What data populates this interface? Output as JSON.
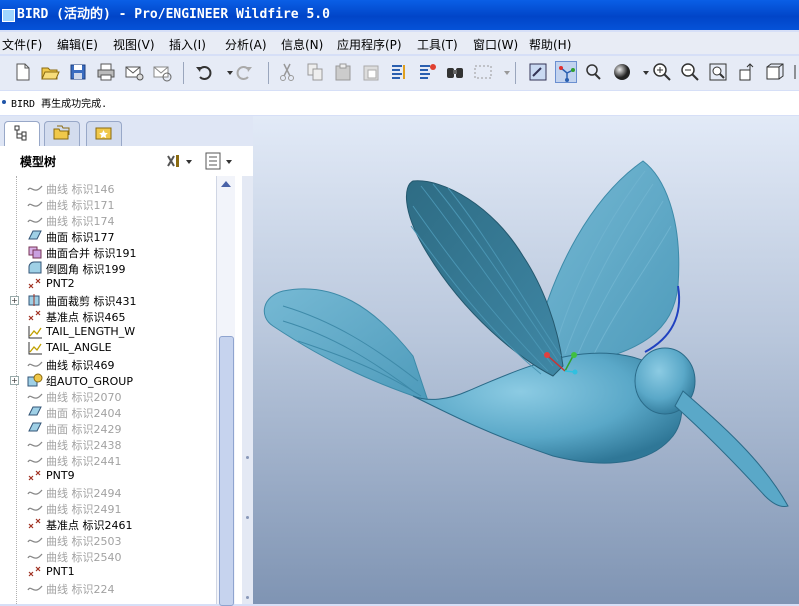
{
  "window": {
    "title": "BIRD (活动的) - Pro/ENGINEER Wildfire 5.0"
  },
  "menu": [
    {
      "label": "文件(F)"
    },
    {
      "label": "编辑(E)"
    },
    {
      "label": "视图(V)"
    },
    {
      "label": "插入(I)"
    },
    {
      "label": "分析(A)"
    },
    {
      "label": "信息(N)"
    },
    {
      "label": "应用程序(P)"
    },
    {
      "label": "工具(T)"
    },
    {
      "label": "窗口(W)"
    },
    {
      "label": "帮助(H)"
    }
  ],
  "toolbar_icons": [
    "new-icon",
    "open-icon",
    "save-icon",
    "print-icon",
    "email-icon",
    "email-link-icon",
    "undo-icon",
    "redo-icon",
    "cut-icon",
    "copy-icon",
    "paste-icon",
    "paste-special-icon",
    "regenerate-icon",
    "regen-manager-icon",
    "find-icon",
    "select-box-icon",
    "repaint-icon",
    "spin-center-icon",
    "orientation-mode-icon",
    "shading-icon",
    "zoom-in-icon",
    "zoom-out-icon",
    "refit-icon",
    "reorient-icon",
    "saved-views-icon",
    "layers-icon"
  ],
  "status": {
    "message": "BIRD 再生成功完成."
  },
  "navigator": {
    "tabs": [
      "model-tree-tab",
      "folder-browser-tab",
      "favorites-tab"
    ],
    "title": "模型树"
  },
  "tree": [
    {
      "label": "曲线 标识146",
      "icon": "curve-icon",
      "dim": true
    },
    {
      "label": "曲线 标识171",
      "icon": "curve-icon",
      "dim": true
    },
    {
      "label": "曲线 标识174",
      "icon": "curve-icon",
      "dim": true
    },
    {
      "label": "曲面 标识177",
      "icon": "surface-icon",
      "dim": false
    },
    {
      "label": "曲面合并 标识191",
      "icon": "merge-icon",
      "dim": false
    },
    {
      "label": "倒圆角 标识199",
      "icon": "round-icon",
      "dim": false
    },
    {
      "label": "PNT2",
      "icon": "datum-point-icon",
      "dim": false
    },
    {
      "label": "曲面裁剪 标识431",
      "icon": "trim-icon",
      "dim": false,
      "expandable": true
    },
    {
      "label": "基准点 标识465",
      "icon": "datum-point-icon",
      "dim": false
    },
    {
      "label": "TAIL_LENGTH_W",
      "icon": "graph-icon",
      "dim": false
    },
    {
      "label": "TAIL_ANGLE",
      "icon": "graph-icon",
      "dim": false
    },
    {
      "label": "曲线 标识469",
      "icon": "curve-icon",
      "dim": false
    },
    {
      "label": "组AUTO_GROUP",
      "icon": "group-icon",
      "dim": false,
      "expandable": true
    },
    {
      "label": "曲线 标识2070",
      "icon": "curve-icon",
      "dim": true
    },
    {
      "label": "曲面 标识2404",
      "icon": "surface-icon",
      "dim": true
    },
    {
      "label": "曲面 标识2429",
      "icon": "surface-icon",
      "dim": true
    },
    {
      "label": "曲线 标识2438",
      "icon": "curve-icon",
      "dim": true
    },
    {
      "label": "曲线 标识2441",
      "icon": "curve-icon",
      "dim": true
    },
    {
      "label": "PNT9",
      "icon": "datum-point-icon",
      "dim": false
    },
    {
      "label": "曲线 标识2494",
      "icon": "curve-icon",
      "dim": true
    },
    {
      "label": "曲线 标识2491",
      "icon": "curve-icon",
      "dim": true
    },
    {
      "label": "基准点 标识2461",
      "icon": "datum-point-icon",
      "dim": false
    },
    {
      "label": "曲线 标识2503",
      "icon": "curve-icon",
      "dim": true
    },
    {
      "label": "曲线 标识2540",
      "icon": "curve-icon",
      "dim": true
    },
    {
      "label": "PNT1",
      "icon": "datum-point-icon",
      "dim": false
    },
    {
      "label": "曲线 标识224",
      "icon": "curve-icon",
      "dim": true
    }
  ],
  "colors": {
    "titlebar": "#0552d8",
    "model": "#5aa8c8"
  }
}
